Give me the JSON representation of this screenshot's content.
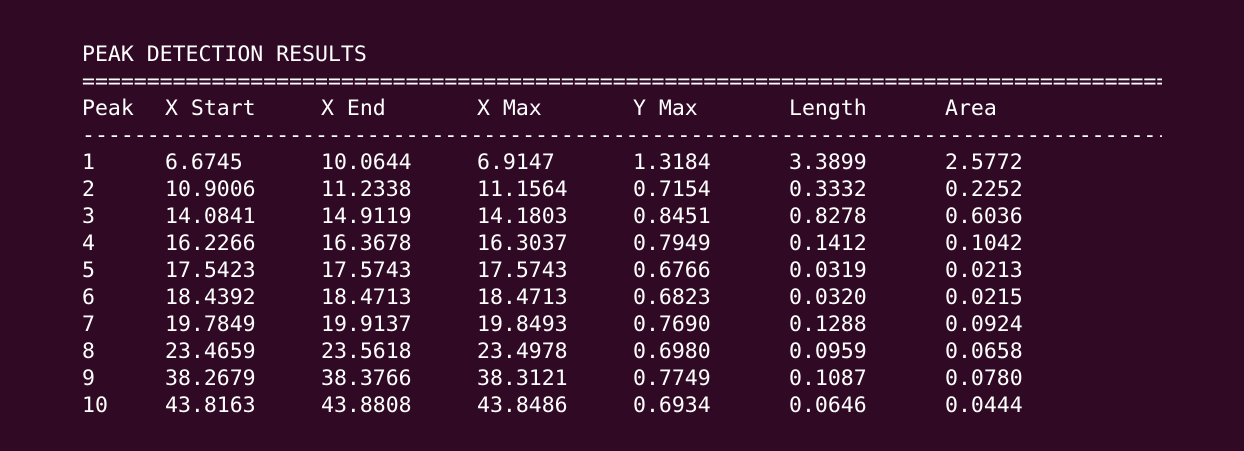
{
  "title": "PEAK DETECTION RESULTS",
  "rule_equals": "===============================================================================================",
  "rule_dashes": "-----------------------------------------------------------------------------------------------",
  "columns": [
    "Peak",
    "X Start",
    "X End",
    "X Max",
    "Y Max",
    "Length",
    "Area"
  ],
  "rows": [
    [
      "1",
      "6.6745",
      "10.0644",
      "6.9147",
      "1.3184",
      "3.3899",
      "2.5772"
    ],
    [
      "2",
      "10.9006",
      "11.2338",
      "11.1564",
      "0.7154",
      "0.3332",
      "0.2252"
    ],
    [
      "3",
      "14.0841",
      "14.9119",
      "14.1803",
      "0.8451",
      "0.8278",
      "0.6036"
    ],
    [
      "4",
      "16.2266",
      "16.3678",
      "16.3037",
      "0.7949",
      "0.1412",
      "0.1042"
    ],
    [
      "5",
      "17.5423",
      "17.5743",
      "17.5743",
      "0.6766",
      "0.0319",
      "0.0213"
    ],
    [
      "6",
      "18.4392",
      "18.4713",
      "18.4713",
      "0.6823",
      "0.0320",
      "0.0215"
    ],
    [
      "7",
      "19.7849",
      "19.9137",
      "19.8493",
      "0.7690",
      "0.1288",
      "0.0924"
    ],
    [
      "8",
      "23.4659",
      "23.5618",
      "23.4978",
      "0.6980",
      "0.0959",
      "0.0658"
    ],
    [
      "9",
      "38.2679",
      "38.3766",
      "38.3121",
      "0.7749",
      "0.1087",
      "0.0780"
    ],
    [
      "10",
      "43.8163",
      "43.8808",
      "43.8486",
      "0.6934",
      "0.0646",
      "0.0444"
    ]
  ]
}
